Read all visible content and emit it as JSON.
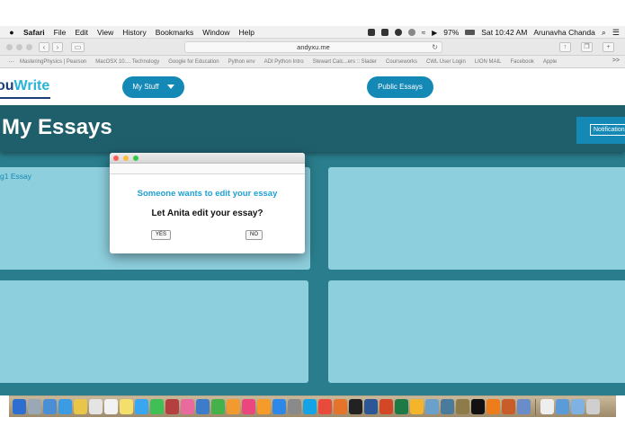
{
  "menubar": {
    "app": "Safari",
    "items": [
      "File",
      "Edit",
      "View",
      "History",
      "Bookmarks",
      "Window",
      "Help"
    ],
    "battery": "97%",
    "clock": "Sat 10:42 AM",
    "user": "Arunavha Chanda"
  },
  "browser": {
    "url": "andyxu.me",
    "bookmarks": [
      "MasteringPhysics | Pearson",
      "MacOSX 10.... Technology",
      "Google for Education",
      "Python env",
      "ADI Python Intro",
      "Stewart Calc...ers :: Slader",
      "Courseworks",
      "CWL User Login",
      "LION MAIL",
      "Facebook",
      "Apple"
    ],
    "bookmarks_more": ">>"
  },
  "site": {
    "logo_prefix": "ou",
    "logo_suffix": "Write",
    "nav": {
      "my_stuff": "My Stuff",
      "public_essays": "Public Essays"
    },
    "page_title": "My Essays",
    "notifications": "Notification",
    "first_card_label": "g1 Essay"
  },
  "dialog": {
    "heading": "Someone wants to edit your essay",
    "question": "Let Anita edit your essay?",
    "yes": "YES",
    "no": "NO"
  },
  "dock": {
    "icons": [
      "finder-icon",
      "launchpad-icon",
      "preview-icon",
      "safari-icon",
      "notes-icon",
      "calendar-icon",
      "textedit-icon",
      "stickies-icon",
      "messages-icon",
      "facetime-icon",
      "photo-booth-icon",
      "photos-icon",
      "keynote-icon",
      "numbers-icon",
      "pages-icon",
      "itunes-icon",
      "ibooks-icon",
      "app-store-icon",
      "system-preferences-icon",
      "skype-icon",
      "chrome-icon",
      "firefox-icon",
      "dashboard-icon",
      "word-icon",
      "powerpoint-icon",
      "excel-icon",
      "sketch-icon",
      "utility-icon",
      "image-capture-icon",
      "archive-icon",
      "terminal-icon",
      "vlc-icon",
      "matlab-icon",
      "virtualbox-icon",
      "document-icon",
      "downloads-icon",
      "folder-icon",
      "trash-icon"
    ]
  }
}
